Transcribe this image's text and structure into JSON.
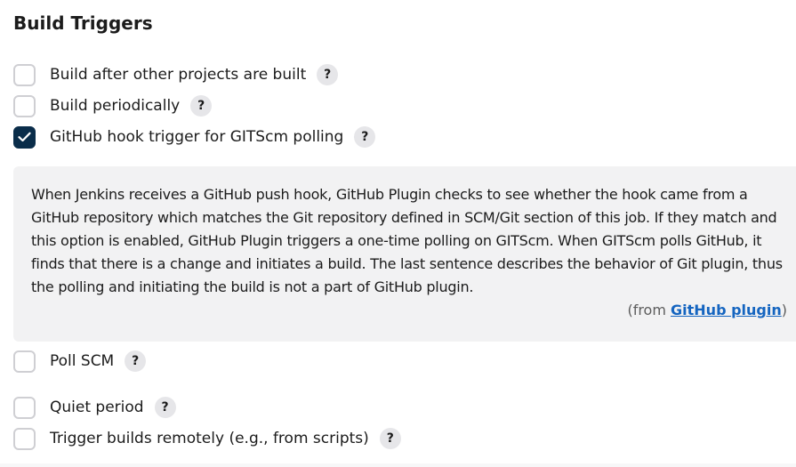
{
  "section_title": "Build Triggers",
  "triggers": [
    {
      "label": "Build after other projects are built",
      "checked": false,
      "help": "?"
    },
    {
      "label": "Build periodically",
      "checked": false,
      "help": "?"
    },
    {
      "label": "GitHub hook trigger for GITScm polling",
      "checked": true,
      "help": "?"
    },
    {
      "label": "Poll SCM",
      "checked": false,
      "help": "?"
    },
    {
      "label": "Quiet period",
      "checked": false,
      "help": "?"
    },
    {
      "label": "Trigger builds remotely (e.g., from scripts)",
      "checked": false,
      "help": "?"
    }
  ],
  "help_panel": {
    "text": "When Jenkins receives a GitHub push hook, GitHub Plugin checks to see whether the hook came from a GitHub repository which matches the Git repository defined in SCM/Git section of this job. If they match and this option is enabled, GitHub Plugin triggers a one-time polling on GITScm. When GITScm polls GitHub, it finds that there is a change and initiates a build. The last sentence describes the behavior of Git plugin, thus the polling and initiating the build is not a part of GitHub plugin.",
    "from_prefix": "(from ",
    "from_link": "GitHub plugin",
    "from_suffix": ")"
  },
  "colors": {
    "checked_bg": "#0a2d4a",
    "link": "#1565c0",
    "panel_bg": "#f2f2f3"
  },
  "icons": {
    "checkmark": "checkmark-icon",
    "help": "help-icon"
  }
}
